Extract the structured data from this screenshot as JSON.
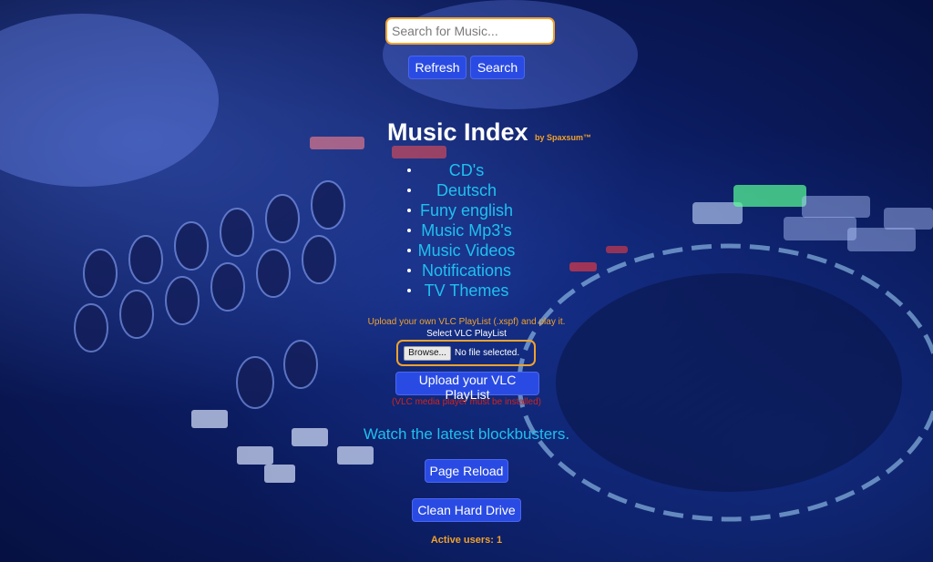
{
  "search": {
    "placeholder": "Search for Music...",
    "value": ""
  },
  "buttons": {
    "refresh": "Refresh",
    "search": "Search",
    "upload_playlist": "Upload your VLC PlayList",
    "page_reload": "Page Reload",
    "clean_hard_drive": "Clean Hard Drive"
  },
  "header": {
    "title": "Music Index",
    "byline": "by Spaxsum™"
  },
  "menu": {
    "items": [
      {
        "label": "CD's"
      },
      {
        "label": "Deutsch"
      },
      {
        "label": "Funy english"
      },
      {
        "label": "Music Mp3's"
      },
      {
        "label": "Music Videos"
      },
      {
        "label": "Notifications"
      },
      {
        "label": "TV Themes"
      }
    ]
  },
  "upload": {
    "note": "Upload your own VLC PlayList (.xspf) and play it.",
    "select_label": "Select VLC PlayList",
    "browse_label": "Browse...",
    "file_status": "No file selected.",
    "warning": "(VLC media player must be installed)"
  },
  "watch_text": "Watch the latest blockbusters.",
  "status": {
    "active_users": "Active users: 1"
  },
  "colors": {
    "accent_orange": "#f0a22c",
    "link_cyan": "#1fc0f0",
    "button_blue": "#2a4be3",
    "warning_red": "#d0241c"
  },
  "background": "dj-controller-photo"
}
